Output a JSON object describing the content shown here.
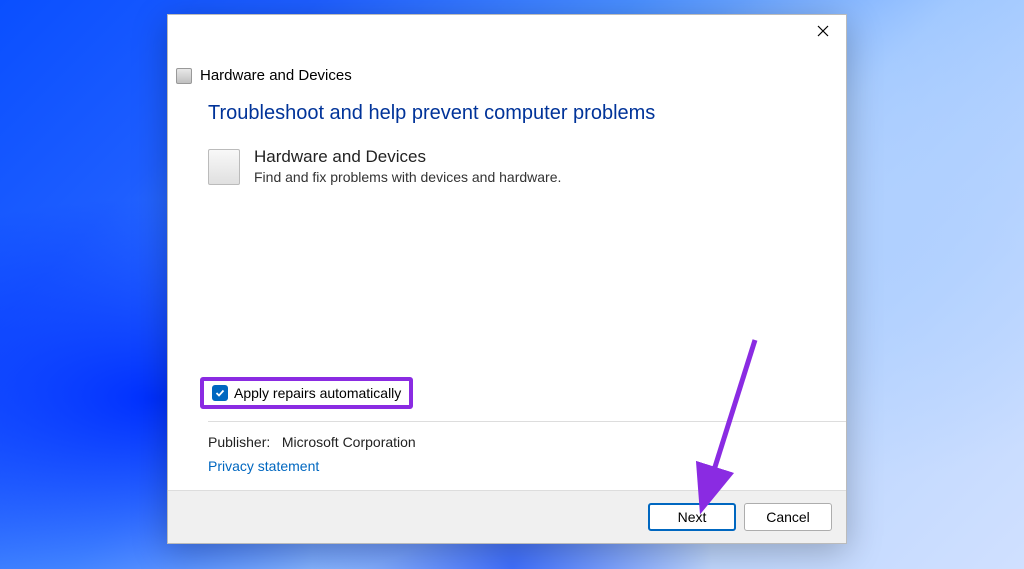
{
  "window": {
    "header_title": "Hardware and Devices"
  },
  "main": {
    "title": "Troubleshoot and help prevent computer problems",
    "item_title": "Hardware and Devices",
    "item_desc": "Find and fix problems with devices and hardware."
  },
  "options": {
    "apply_repairs_label": "Apply repairs automatically",
    "apply_repairs_checked": true
  },
  "publisher": {
    "label": "Publisher:",
    "value": "Microsoft Corporation"
  },
  "links": {
    "privacy": "Privacy statement"
  },
  "buttons": {
    "next": "Next",
    "cancel": "Cancel"
  }
}
